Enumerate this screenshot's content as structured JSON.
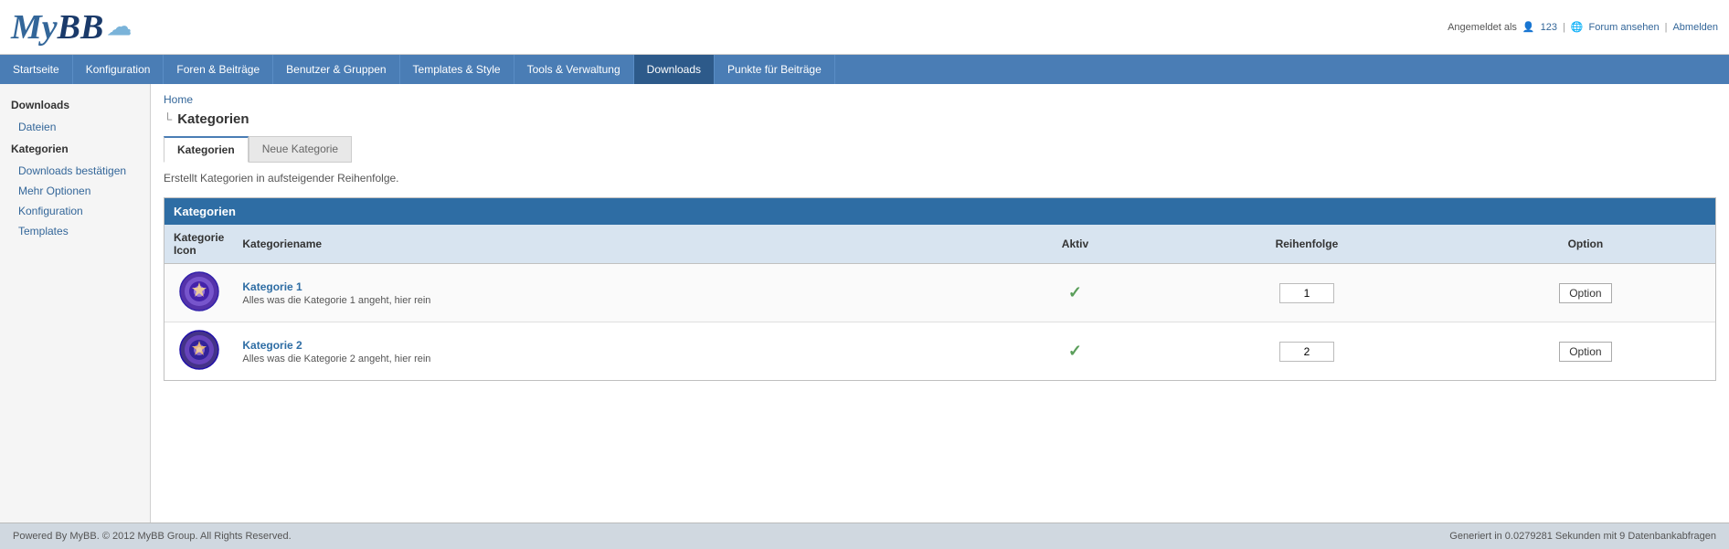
{
  "header": {
    "logo_my": "My",
    "logo_bb": "BB",
    "user_label": "Angemeldet als",
    "user_icon": "👤",
    "username": "123",
    "forum_link": "Forum ansehen",
    "logout_link": "Abmelden"
  },
  "navbar": {
    "items": [
      {
        "id": "startseite",
        "label": "Startseite",
        "active": false
      },
      {
        "id": "konfiguration",
        "label": "Konfiguration",
        "active": false
      },
      {
        "id": "foren-beitraege",
        "label": "Foren & Beiträge",
        "active": false
      },
      {
        "id": "benutzer-gruppen",
        "label": "Benutzer & Gruppen",
        "active": false
      },
      {
        "id": "templates-style",
        "label": "Templates & Style",
        "active": false
      },
      {
        "id": "tools-verwaltung",
        "label": "Tools & Verwaltung",
        "active": false
      },
      {
        "id": "downloads",
        "label": "Downloads",
        "active": true
      },
      {
        "id": "punkte-beitraege",
        "label": "Punkte für Beiträge",
        "active": false
      }
    ]
  },
  "sidebar": {
    "heading": "Downloads",
    "items": [
      {
        "id": "dateien",
        "label": "Dateien",
        "active": false
      },
      {
        "id": "kategorien",
        "label": "Kategorien",
        "active": true,
        "is_heading": true
      },
      {
        "id": "downloads-bestaetigen",
        "label": "Downloads bestätigen",
        "active": false
      },
      {
        "id": "mehr-optionen",
        "label": "Mehr Optionen",
        "active": false
      },
      {
        "id": "konfiguration",
        "label": "Konfiguration",
        "active": false
      },
      {
        "id": "templates",
        "label": "Templates",
        "active": false
      }
    ]
  },
  "content": {
    "breadcrumb_home": "Home",
    "page_title": "Kategorien",
    "tabs": [
      {
        "id": "kategorien",
        "label": "Kategorien",
        "active": true
      },
      {
        "id": "neue-kategorie",
        "label": "Neue Kategorie",
        "active": false
      }
    ],
    "description": "Erstellt Kategorien in aufsteigender Reihenfolge.",
    "table": {
      "header": "Kategorien",
      "columns": [
        {
          "id": "icon",
          "label": "Kategorie Icon"
        },
        {
          "id": "name",
          "label": "Kategoriename"
        },
        {
          "id": "aktiv",
          "label": "Aktiv"
        },
        {
          "id": "reihenfolge",
          "label": "Reihenfolge"
        },
        {
          "id": "option",
          "label": "Option"
        }
      ],
      "rows": [
        {
          "id": "kat1",
          "icon_type": "purple1",
          "name": "Kategorie 1",
          "description": "Alles was die Kategorie 1 angeht, hier rein",
          "aktiv": true,
          "reihenfolge": "1",
          "option_label": "Option"
        },
        {
          "id": "kat2",
          "icon_type": "purple2",
          "name": "Kategorie 2",
          "description": "Alles was die Kategorie 2 angeht, hier rein",
          "aktiv": true,
          "reihenfolge": "2",
          "option_label": "Option"
        }
      ]
    }
  },
  "footer": {
    "left": "Powered By MyBB. © 2012 MyBB Group. All Rights Reserved.",
    "right": "Generiert in 0.0279281 Sekunden mit 9 Datenbankabfragen"
  }
}
